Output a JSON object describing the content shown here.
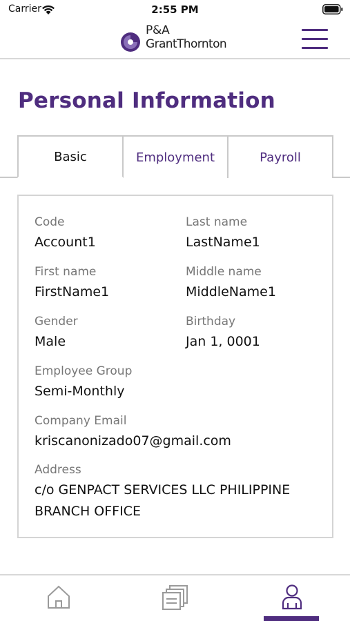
{
  "status_bar": {
    "carrier": "Carrier",
    "time": "2:55 PM",
    "icons": [
      "wifi-icon",
      "battery-icon"
    ]
  },
  "header": {
    "logo_line1": "P&A",
    "logo_line2": "GrantThornton",
    "menu_icon": "hamburger-menu-icon"
  },
  "page": {
    "title": "Personal Information"
  },
  "tabs": [
    {
      "label": "Basic",
      "active": true
    },
    {
      "label": "Employment",
      "active": false
    },
    {
      "label": "Payroll",
      "active": false
    }
  ],
  "fields": {
    "code": {
      "label": "Code",
      "value": "Account1"
    },
    "last_name": {
      "label": "Last name",
      "value": "LastName1"
    },
    "first_name": {
      "label": "First name",
      "value": "FirstName1"
    },
    "middle_name": {
      "label": "Middle name",
      "value": "MiddleName1"
    },
    "gender": {
      "label": "Gender",
      "value": "Male"
    },
    "birthday": {
      "label": "Birthday",
      "value": "Jan 1, 0001"
    },
    "employee_group": {
      "label": "Employee Group",
      "value": "Semi-Monthly"
    },
    "company_email": {
      "label": "Company Email",
      "value": "kriscanonizado07@gmail.com"
    },
    "address": {
      "label": "Address",
      "value": "c/o GENPACT SERVICES LLC PHILIPPINE BRANCH OFFICE"
    }
  },
  "bottom_nav": {
    "items": [
      {
        "icon": "home-icon",
        "active": false
      },
      {
        "icon": "documents-icon",
        "active": false
      },
      {
        "icon": "profile-icon",
        "active": true
      }
    ]
  },
  "colors": {
    "brand_purple": "#4f2d7f",
    "label_gray": "#777777",
    "border_gray": "#c9c9c9"
  }
}
